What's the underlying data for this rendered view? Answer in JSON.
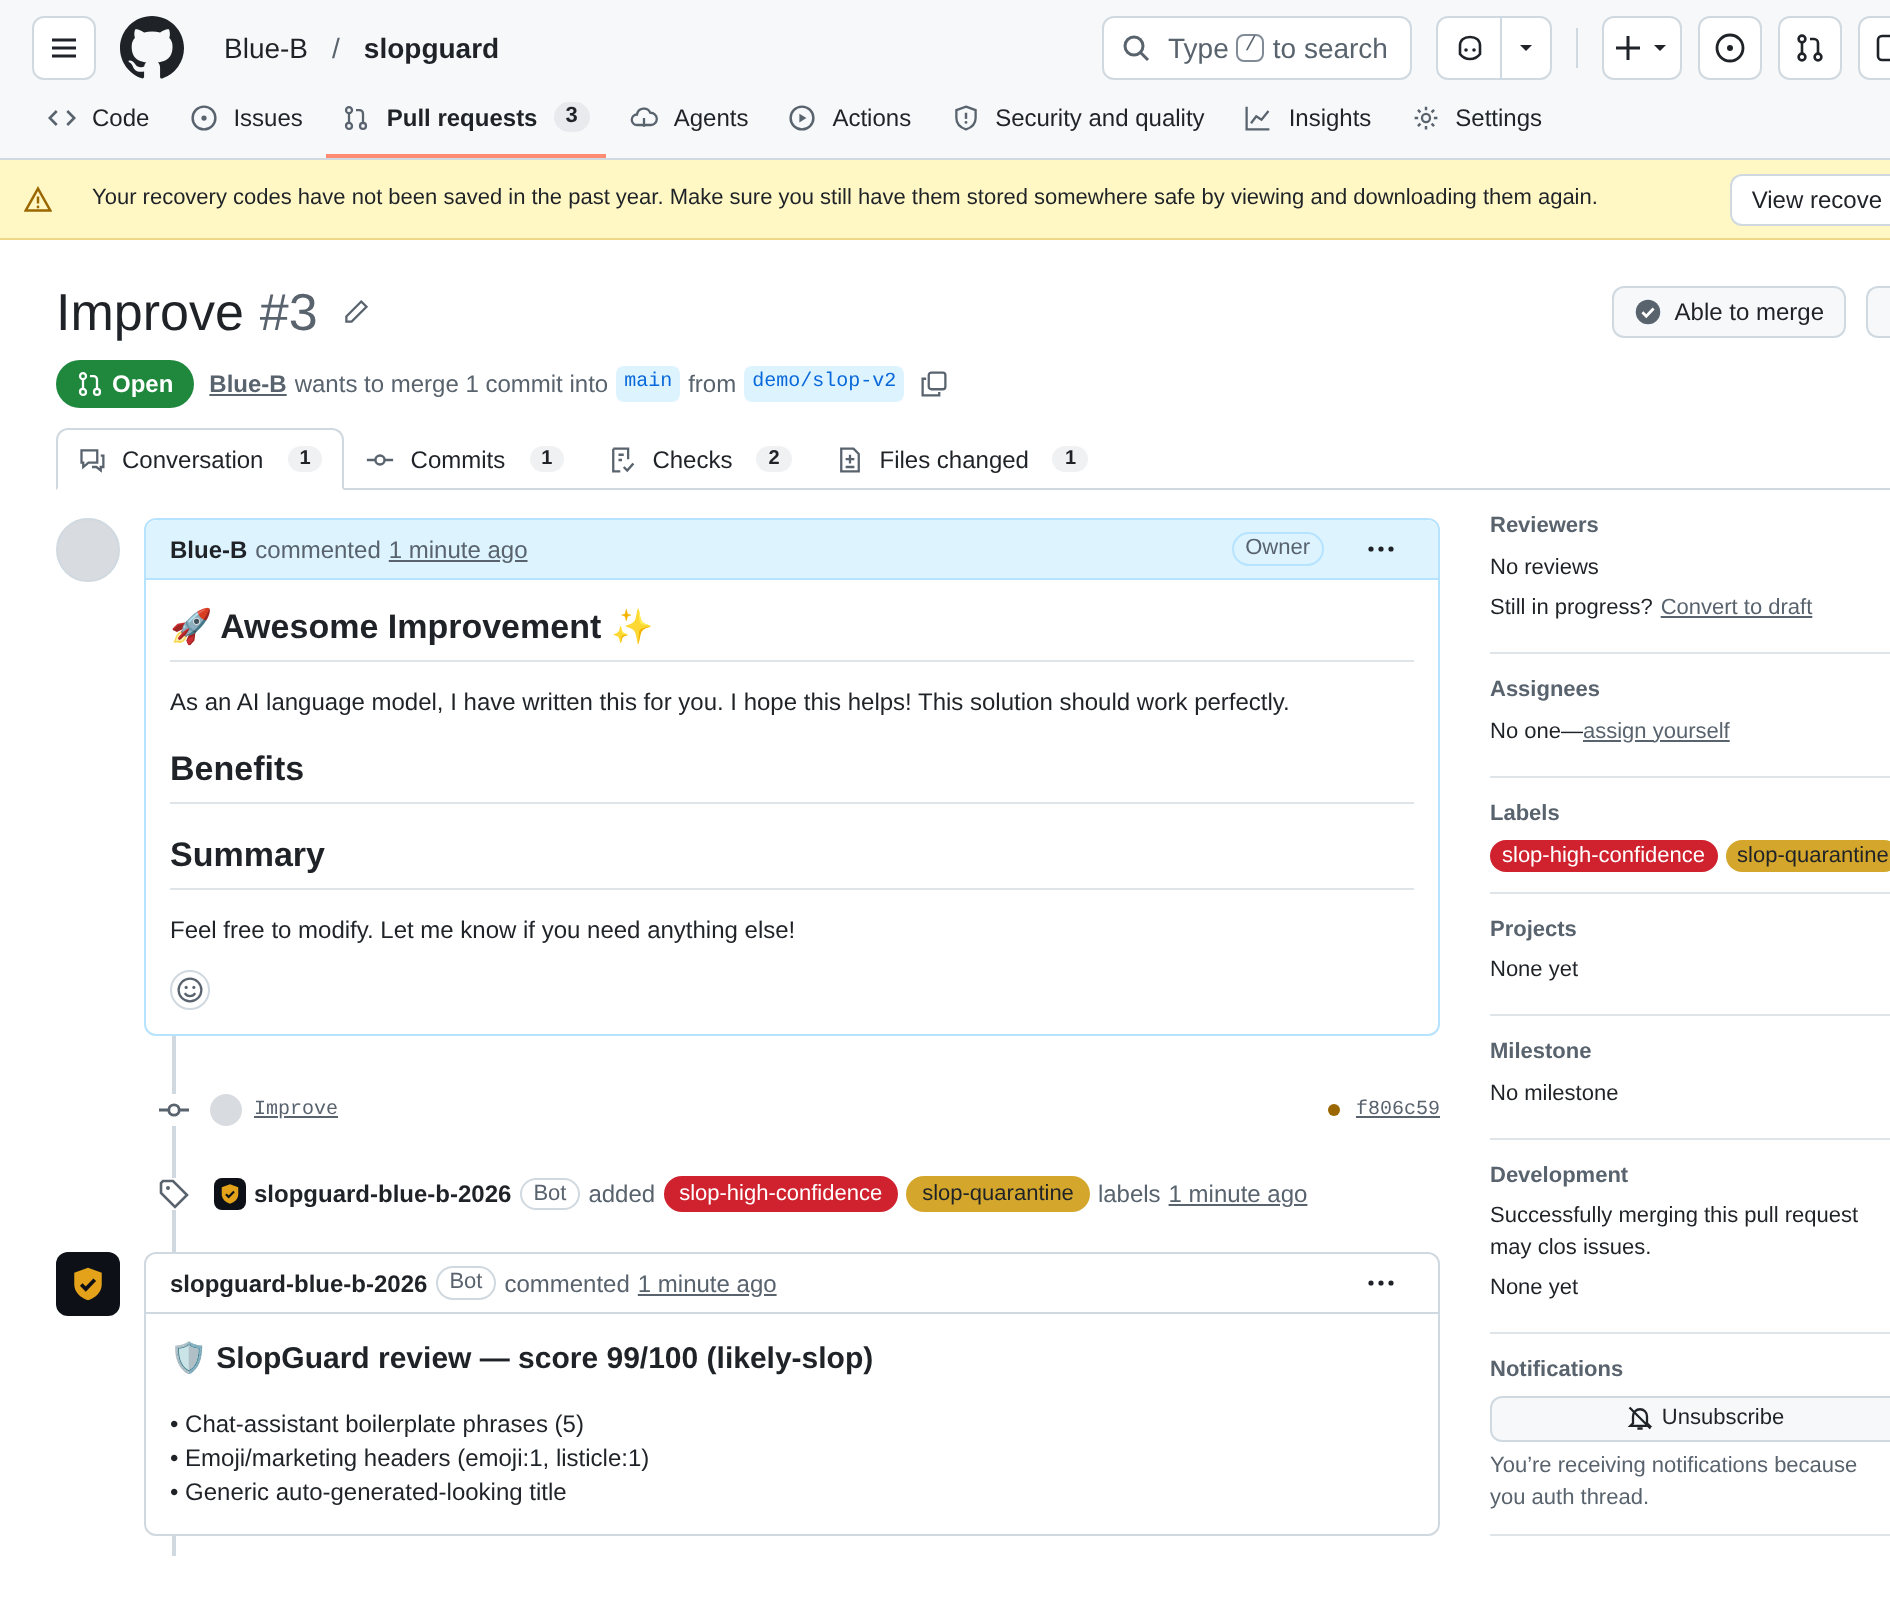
{
  "header": {
    "owner": "Blue-B",
    "separator": "/",
    "repo": "slopguard",
    "search": {
      "before": "Type",
      "key": "/",
      "after": "to search"
    }
  },
  "repo_nav": [
    {
      "label": "Code",
      "selected": false
    },
    {
      "label": "Issues",
      "selected": false
    },
    {
      "label": "Pull requests",
      "count": "3",
      "selected": true
    },
    {
      "label": "Agents",
      "selected": false
    },
    {
      "label": "Actions",
      "selected": false
    },
    {
      "label": "Security and quality",
      "selected": false
    },
    {
      "label": "Insights",
      "selected": false
    },
    {
      "label": "Settings",
      "selected": false
    }
  ],
  "banner": {
    "message": "Your recovery codes have not been saved in the past year. Make sure you still have them stored somewhere safe by viewing and downloading them again.",
    "button": "View recove"
  },
  "pr": {
    "title": "Improve",
    "number": "#3",
    "state": "Open",
    "author": "Blue-B",
    "summary": "wants to merge 1 commit into",
    "base": "main",
    "from": "from",
    "head": "demo/slop-v2",
    "merge_button": "Able to merge"
  },
  "tabs": [
    {
      "label": "Conversation",
      "count": "1",
      "selected": true
    },
    {
      "label": "Commits",
      "count": "1",
      "selected": false
    },
    {
      "label": "Checks",
      "count": "2",
      "selected": false
    },
    {
      "label": "Files changed",
      "count": "1",
      "selected": false
    }
  ],
  "timeline": [
    {
      "kind": "comment",
      "author": "Blue-B",
      "verb": "commented",
      "time": "1 minute ago",
      "role": "Owner",
      "highlighted": true,
      "body": [
        {
          "kind": "h1",
          "text": "🚀 Awesome Improvement ✨"
        },
        {
          "kind": "p",
          "text": "As an AI language model, I have written this for you. I hope this helps! This solution should work perfectly."
        },
        {
          "kind": "h2",
          "text": "Benefits"
        },
        {
          "kind": "h2",
          "text": "Summary"
        },
        {
          "kind": "p",
          "text": "Feel free to modify. Let me know if you need anything else!"
        }
      ],
      "reactions": true
    },
    {
      "kind": "commit",
      "message": "Improve",
      "sha": "f806c59"
    },
    {
      "kind": "labeled",
      "actor": "slopguard-blue-b-2026",
      "badge": "Bot",
      "verb": "added",
      "labels": [
        {
          "name": "slop-high-confidence",
          "color": "#cf222e"
        },
        {
          "name": "slop-quarantine",
          "color": "#d4a72c"
        }
      ],
      "suffix": "labels",
      "time": "1 minute ago"
    },
    {
      "kind": "comment",
      "author": "slopguard-blue-b-2026",
      "badge": "Bot",
      "verb": "commented",
      "time": "1 minute ago",
      "highlighted": false,
      "body": [
        {
          "kind": "h3",
          "text": "🛡️ SlopGuard review — score 99/100 (likely-slop)"
        },
        {
          "kind": "li",
          "text": "• Chat-assistant boilerplate phrases (5)"
        },
        {
          "kind": "li",
          "text": "• Emoji/marketing headers (emoji:1, listicle:1)"
        },
        {
          "kind": "li",
          "text": "• Generic auto-generated-looking title"
        }
      ],
      "reactions": false
    }
  ],
  "sidebar": [
    {
      "heading": "Reviewers",
      "lines": [
        {
          "text": "No reviews"
        },
        {
          "text": "Still in progress?",
          "link": "Convert to draft",
          "tight": false
        }
      ]
    },
    {
      "heading": "Assignees",
      "lines": [
        {
          "text": "No one—",
          "link": "assign yourself",
          "tight": true
        }
      ]
    },
    {
      "heading": "Labels",
      "labels": [
        {
          "name": "slop-high-confidence",
          "color": "#cf222e"
        },
        {
          "name": "slop-quarantine",
          "color": "#d4a72c"
        }
      ]
    },
    {
      "heading": "Projects",
      "lines": [
        {
          "text": "None yet"
        }
      ]
    },
    {
      "heading": "Milestone",
      "lines": [
        {
          "text": "No milestone"
        }
      ]
    },
    {
      "heading": "Development",
      "lines": [
        {
          "text": "Successfully merging this pull request may clos issues."
        },
        {
          "text": "None yet"
        }
      ]
    },
    {
      "heading": "Notifications",
      "button": "Unsubscribe",
      "note": "You’re receiving notifications because you auth thread."
    }
  ]
}
